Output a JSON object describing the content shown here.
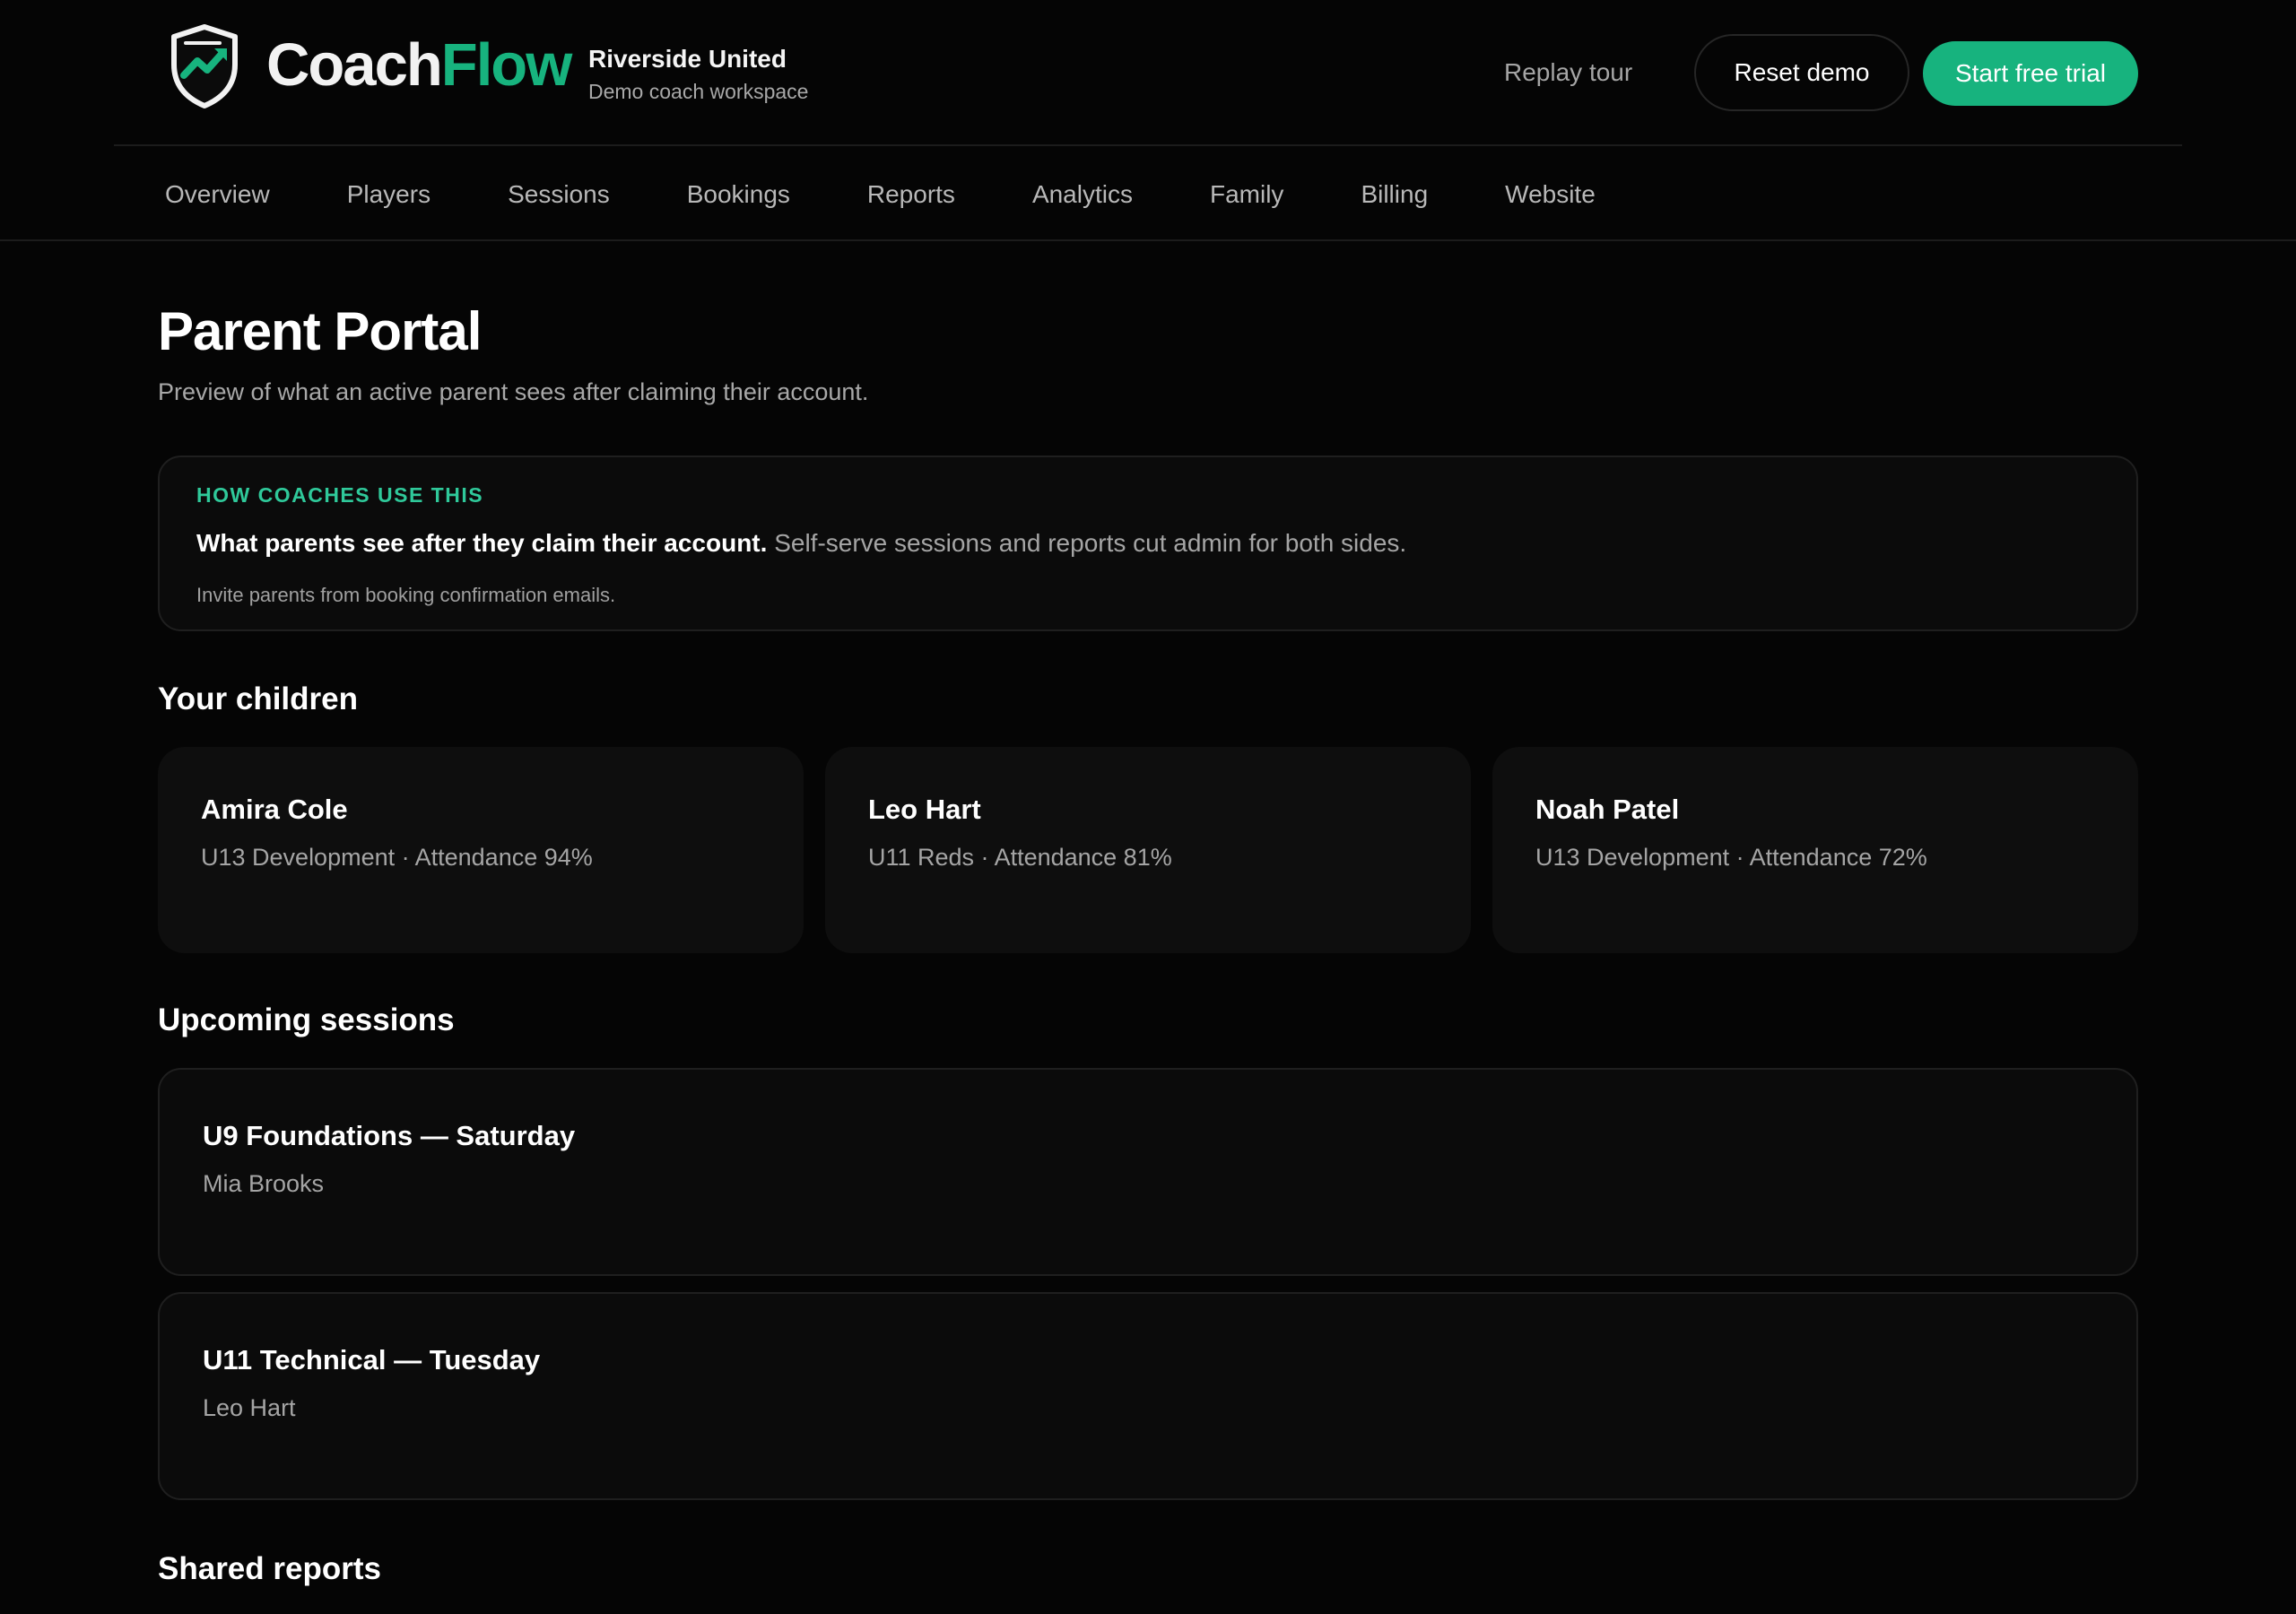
{
  "brand": {
    "logo_part1": "Coach",
    "logo_part2": "Flow",
    "accent_color": "#17b37e"
  },
  "workspace": {
    "name": "Riverside United",
    "subtitle": "Demo coach workspace"
  },
  "header_actions": {
    "replay_tour": "Replay tour",
    "reset_demo": "Reset demo",
    "start_trial": "Start free trial"
  },
  "nav": {
    "items": [
      "Overview",
      "Players",
      "Sessions",
      "Bookings",
      "Reports",
      "Analytics",
      "Family",
      "Billing",
      "Website"
    ]
  },
  "page": {
    "title": "Parent Portal",
    "subtitle": "Preview of what an active parent sees after claiming their account."
  },
  "callout": {
    "eyebrow": "HOW COACHES USE THIS",
    "strong_text": "What parents see after they claim their account.",
    "muted_text": " Self-serve sessions and reports cut admin for both sides.",
    "note": "Invite parents from booking confirmation emails."
  },
  "children_section": {
    "heading": "Your children",
    "children": [
      {
        "name": "Amira Cole",
        "meta": "U13 Development · Attendance 94%"
      },
      {
        "name": "Leo Hart",
        "meta": "U11 Reds · Attendance 81%"
      },
      {
        "name": "Noah Patel",
        "meta": "U13 Development · Attendance 72%"
      }
    ]
  },
  "sessions_section": {
    "heading": "Upcoming sessions",
    "sessions": [
      {
        "title": "U9 Foundations — Saturday",
        "coach": "Mia Brooks"
      },
      {
        "title": "U11 Technical — Tuesday",
        "coach": "Leo Hart"
      }
    ]
  },
  "reports_section": {
    "heading": "Shared reports"
  }
}
